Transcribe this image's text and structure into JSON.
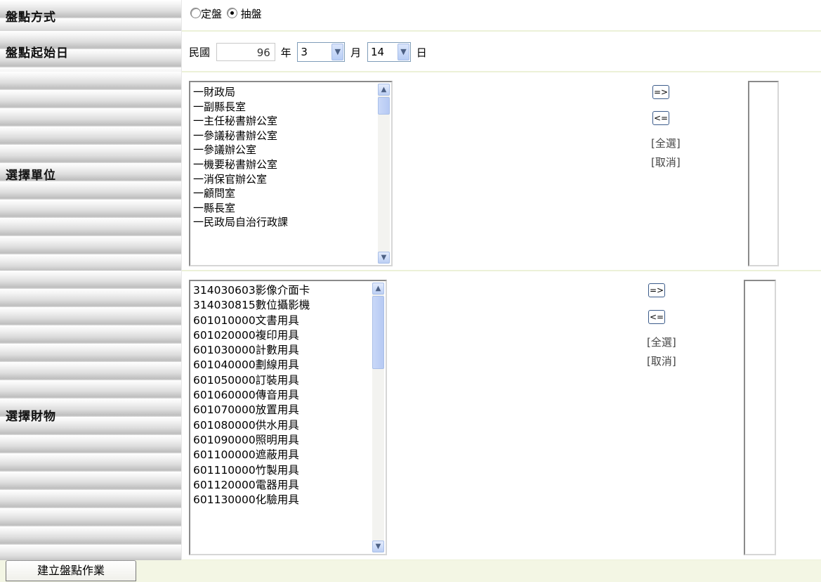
{
  "rows": {
    "method": {
      "label": "盤點方式",
      "options": [
        {
          "label": "定盤",
          "checked": false
        },
        {
          "label": "抽盤",
          "checked": true
        }
      ]
    },
    "start_date": {
      "label": "盤點起始日",
      "era": "民國",
      "year": "96",
      "year_unit": "年",
      "month": "3",
      "month_unit": "月",
      "day": "14",
      "day_unit": "日"
    },
    "units": {
      "label": "選擇單位",
      "items": [
        "一財政局",
        "一副縣長室",
        "一主任秘書辦公室",
        "一參議秘書辦公室",
        "一參議辦公室",
        "一機要秘書辦公室",
        "一消保官辦公室",
        "一顧問室",
        "一縣長室",
        "一民政局自治行政課"
      ],
      "add": "=>",
      "remove": "<=",
      "select_all": "[全選]",
      "cancel": "[取消]"
    },
    "assets": {
      "label": "選擇財物",
      "items": [
        "314030603影像介面卡",
        "314030815數位攝影機",
        "601010000文書用具",
        "601020000複印用具",
        "601030000計數用具",
        "601040000劃線用具",
        "601050000訂裝用具",
        "601060000傳音用具",
        "601070000放置用具",
        "601080000供水用具",
        "601090000照明用具",
        "601100000遮蔽用具",
        "601110000竹製用具",
        "601120000電器用具",
        "601130000化驗用具"
      ],
      "add": "=>",
      "remove": "<=",
      "select_all": "[全選]",
      "cancel": "[取消]"
    }
  },
  "submit_label": "建立盤點作業",
  "icons": {
    "scroll_up": "▲",
    "scroll_down": "▼",
    "dropdown": "▼"
  }
}
